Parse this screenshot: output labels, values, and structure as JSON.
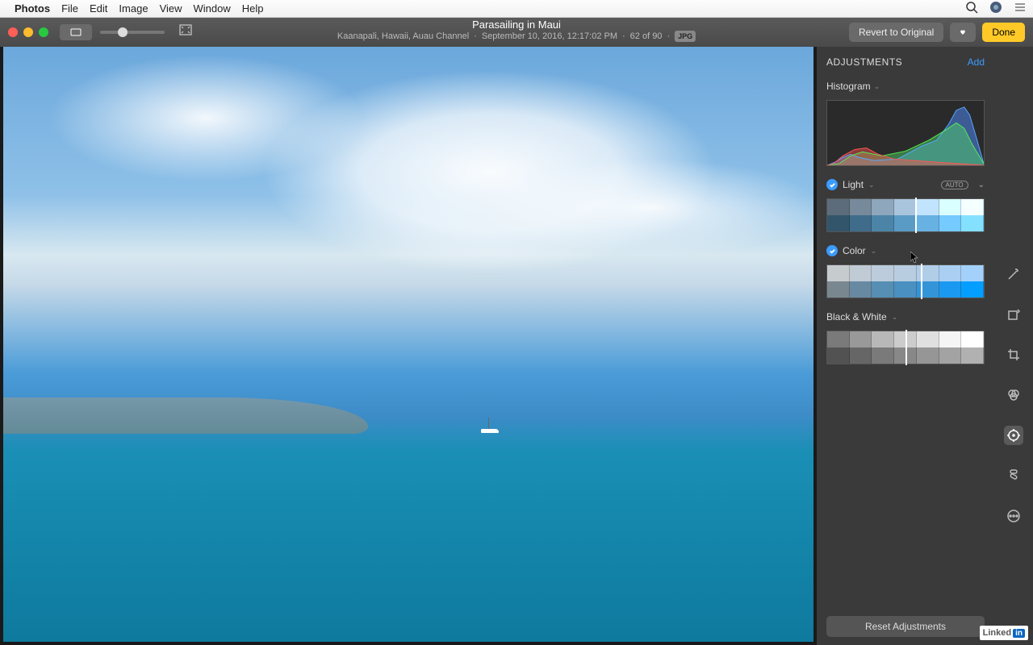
{
  "menubar": {
    "app": "Photos",
    "items": [
      "File",
      "Edit",
      "Image",
      "View",
      "Window",
      "Help"
    ]
  },
  "toolbar": {
    "title": "Parasailing in Maui",
    "subtitle_location": "Kaanapali, Hawaii, Auau Channel",
    "subtitle_date": "September 10, 2016, 12:17:02 PM",
    "subtitle_count": "62 of 90",
    "badge": "JPG",
    "revert": "Revert to Original",
    "done": "Done"
  },
  "panel": {
    "heading": "ADJUSTMENTS",
    "add_label": "Add",
    "histogram_label": "Histogram",
    "light_label": "Light",
    "auto_label": "AUTO",
    "color_label": "Color",
    "bw_label": "Black & White",
    "reset": "Reset Adjustments",
    "light_marker_pct": 56,
    "color_marker_pct": 60,
    "bw_marker_pct": 50
  },
  "watermark": {
    "brand": "Linked",
    "suffix": "in"
  }
}
